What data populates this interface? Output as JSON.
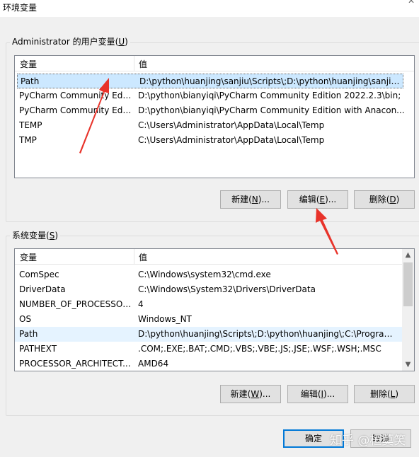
{
  "window": {
    "title": "环境变量"
  },
  "user_section": {
    "label_prefix": "Administrator 的用户变量(",
    "label_key": "U",
    "label_suffix": ")",
    "columns": [
      "变量",
      "值"
    ],
    "rows": [
      {
        "name": "Path",
        "value": "D:\\python\\huanjing\\sanjiu\\Scripts\\;D:\\python\\huanjing\\sanjiu\\...",
        "state": "selected"
      },
      {
        "name": "PyCharm Community Editi...",
        "value": "D:\\python\\bianyiqi\\PyCharm Community Edition 2022.2.3\\bin;"
      },
      {
        "name": "PyCharm Community Editi...",
        "value": "D:\\python\\bianyiqi\\PyCharm Community Edition with Anacon..."
      },
      {
        "name": "TEMP",
        "value": "C:\\Users\\Administrator\\AppData\\Local\\Temp"
      },
      {
        "name": "TMP",
        "value": "C:\\Users\\Administrator\\AppData\\Local\\Temp"
      }
    ],
    "buttons": {
      "new": {
        "pre": "新建(",
        "key": "N",
        "post": ")..."
      },
      "edit": {
        "pre": "编辑(",
        "key": "E",
        "post": ")..."
      },
      "delete": {
        "pre": "删除(",
        "key": "D",
        "post": ")"
      }
    }
  },
  "system_section": {
    "label_prefix": "系统变量(",
    "label_key": "S",
    "label_suffix": ")",
    "columns": [
      "变量",
      "值"
    ],
    "rows": [
      {
        "name": "ComSpec",
        "value": "C:\\Windows\\system32\\cmd.exe"
      },
      {
        "name": "DriverData",
        "value": "C:\\Windows\\System32\\Drivers\\DriverData"
      },
      {
        "name": "NUMBER_OF_PROCESSORS",
        "value": "4"
      },
      {
        "name": "OS",
        "value": "Windows_NT"
      },
      {
        "name": "Path",
        "value": "D:\\python\\huanjing\\Scripts\\;D:\\python\\huanjing\\;C:\\Program ...",
        "state": "hover"
      },
      {
        "name": "PATHEXT",
        "value": ".COM;.EXE;.BAT;.CMD;.VBS;.VBE;.JS;.JSE;.WSF;.WSH;.MSC"
      },
      {
        "name": "PROCESSOR_ARCHITECT...",
        "value": "AMD64"
      }
    ],
    "buttons": {
      "new": {
        "pre": "新建(",
        "key": "W",
        "post": ")..."
      },
      "edit": {
        "pre": "编辑(",
        "key": "I",
        "post": ")..."
      },
      "delete": {
        "pre": "删除(",
        "key": "L",
        "post": ")"
      }
    }
  },
  "footer": {
    "ok_label": "确定",
    "cancel_label": "取消"
  },
  "watermark": "知乎 @桓莫笑",
  "icons": {
    "close": "close-icon",
    "scroll_up": "chevron-up-icon",
    "scroll_down": "chevron-down-icon"
  },
  "colors": {
    "selection": "#cce8ff",
    "hover": "#e5f3ff",
    "focus_border": "#0078d7",
    "annotation_arrow": "#e8332a"
  }
}
